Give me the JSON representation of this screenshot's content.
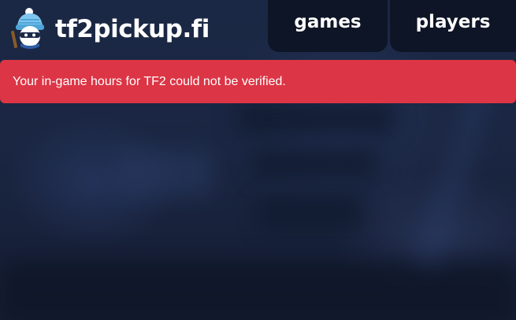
{
  "site": {
    "name": "tf2pickup.fi",
    "logo_icon": "beanie-mascot-icon"
  },
  "nav": {
    "items": [
      {
        "label": "games"
      },
      {
        "label": "players"
      }
    ]
  },
  "alert": {
    "message": "Your in-game hours for TF2 could not be verified.",
    "color": "#dc3545"
  },
  "colors": {
    "background": "#1a2642",
    "nav_bg": "#0d1424"
  }
}
